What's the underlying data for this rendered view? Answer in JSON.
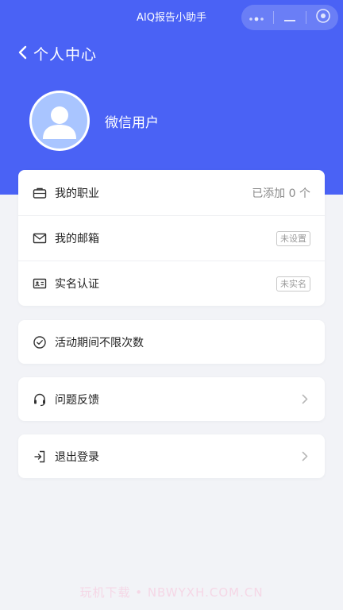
{
  "app_title": "AIQ报告小助手",
  "capsule": {
    "more_icon": "more-dots-icon",
    "minimize_icon": "minimize-icon",
    "close_icon": "close-circle-icon"
  },
  "nav": {
    "back_label": "个人中心"
  },
  "profile": {
    "username": "微信用户"
  },
  "cards": {
    "info": [
      {
        "label": "我的职业",
        "value": "已添加 0 个",
        "icon": "briefcase-icon"
      },
      {
        "label": "我的邮箱",
        "badge": "未设置",
        "icon": "mail-icon"
      },
      {
        "label": "实名认证",
        "badge": "未实名",
        "icon": "id-card-icon"
      }
    ],
    "activity": {
      "label": "活动期间不限次数",
      "icon": "check-circle-icon"
    },
    "feedback": {
      "label": "问题反馈",
      "icon": "headset-icon"
    },
    "logout": {
      "label": "退出登录",
      "icon": "logout-icon"
    }
  },
  "watermark": "玩机下载 • NBWYXH.COM.CN",
  "colors": {
    "header": "#4a62f5",
    "background": "#f2f3f7",
    "avatar": "#a9c5ff"
  }
}
